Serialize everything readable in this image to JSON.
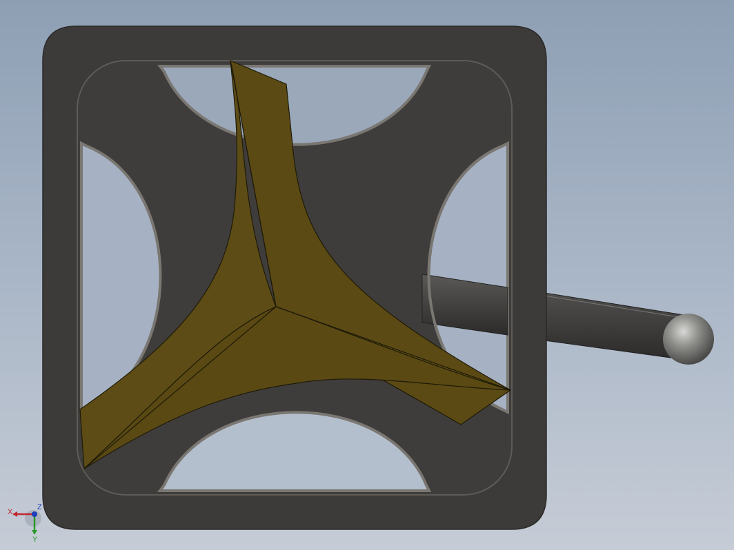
{
  "viewport": {
    "background_top": "#8e9fb4",
    "background_bottom": "#c6ccd6"
  },
  "model": {
    "frame_color": "#3d3b39",
    "frame_edge_color": "#2a2928",
    "bevel_color": "#6f6c68",
    "blade_color": "#5b4a14",
    "blade_edge_color": "#1e1a08",
    "rod_color": "#444341",
    "ball_color": "#8f8f8c"
  },
  "triad": {
    "x_label": "X",
    "y_label": "Y",
    "z_label": "Z",
    "x_color": "#c0262d",
    "y_color": "#2a9a2a",
    "z_color": "#1f3fb8"
  }
}
